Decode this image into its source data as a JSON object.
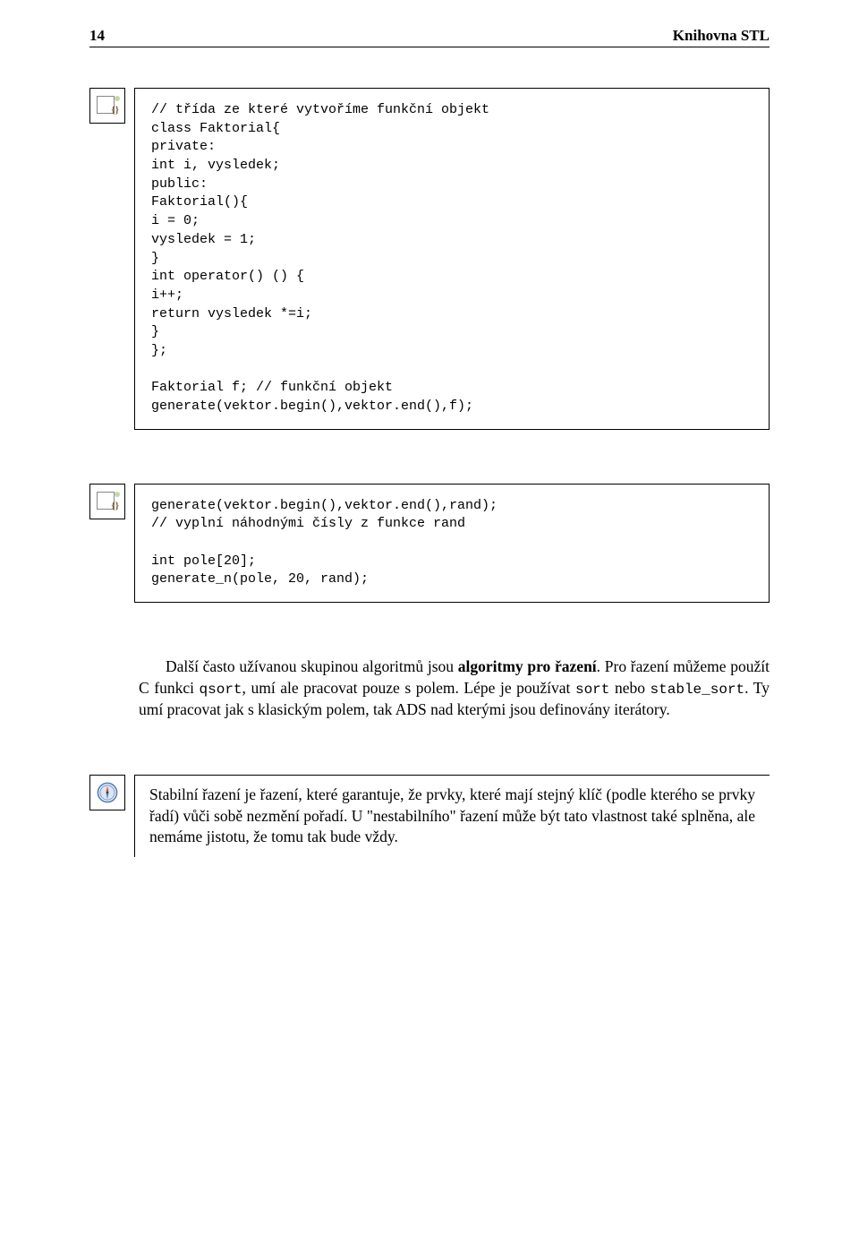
{
  "header": {
    "page_number": "14",
    "chapter_title": "Knihovna STL"
  },
  "code_block_1": "// třída ze které vytvoříme funkční objekt\nclass Faktorial{\nprivate:\nint i, vysledek;\npublic:\nFaktorial(){\ni = 0;\nvysledek = 1;\n}\nint operator() () {\ni++;\nreturn vysledek *=i;\n}\n};\n\nFaktorial f; // funkční objekt\ngenerate(vektor.begin(),vektor.end(),f);",
  "code_block_2": "generate(vektor.begin(),vektor.end(),rand);\n// vyplní náhodnými čísly z funkce rand\n\nint pole[20];\ngenerate_n(pole, 20, rand);",
  "paragraph_1": {
    "text_before_bold": "Další často užívanou skupinou algoritmů jsou ",
    "bold": "algoritmy pro řazení",
    "text_1": ". Pro řazení můžeme použít C funkci ",
    "tt_1": "qsort",
    "text_2": ", umí ale pracovat pouze s polem. Lépe je používat ",
    "tt_2": "sort",
    "text_3": " nebo ",
    "tt_3": "stable_sort",
    "text_4": ". Ty umí pracovat jak s klasickým polem, tak ADS nad kterými jsou definovány iterátory."
  },
  "note_1": "Stabilní řazení je řazení, které garantuje, že prvky, které mají stejný klíč (podle kterého se prvky řadí) vůči sobě nezmění pořadí. U \"nestabilního\" řazení může být tato vlastnost také splněna, ale nemáme jistotu, že tomu tak bude vždy."
}
